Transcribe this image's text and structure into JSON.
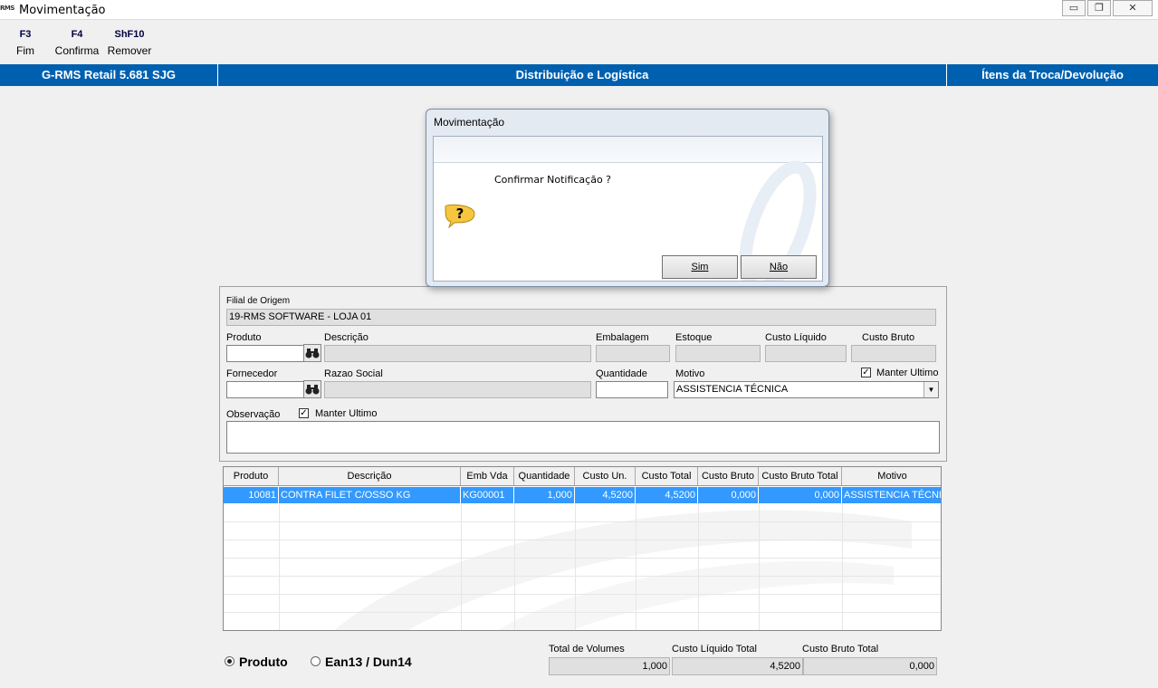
{
  "window": {
    "title": "Movimentação",
    "app_icon_text": "RMS",
    "min": "▭",
    "restore": "❐",
    "close": "✕"
  },
  "fkeys": [
    {
      "key": "F3",
      "label": "Fim"
    },
    {
      "key": "F4",
      "label": "Confirma"
    },
    {
      "key": "ShF10",
      "label": "Remover"
    }
  ],
  "header": {
    "left": "G-RMS Retail 5.681 SJG",
    "center": "Distribuição e Logística",
    "right": "Ítens da Troca/Devolução"
  },
  "form": {
    "filial_label": "Filial de Origem",
    "filial_value": "19-RMS SOFTWARE - LOJA 01",
    "produto_label": "Produto",
    "descricao_label": "Descrição",
    "embalagem_label": "Embalagem",
    "estoque_label": "Estoque",
    "custo_liquido_label": "Custo Líquido",
    "custo_bruto_label": "Custo Bruto",
    "fornecedor_label": "Fornecedor",
    "razao_social_label": "Razao Social",
    "quantidade_label": "Quantidade",
    "motivo_label": "Motivo",
    "motivo_value": "ASSISTENCIA TÉCNICA",
    "manter_ultimo_label": "Manter Ultimo",
    "observacao_label": "Observação",
    "manter_ultimo2_label": "Manter Ultimo"
  },
  "grid": {
    "columns": [
      "Produto",
      "Descrição",
      "Emb Vda",
      "Quantidade",
      "Custo Un.",
      "Custo Total",
      "Custo Bruto",
      "Custo Bruto Total",
      "Motivo"
    ],
    "rows": [
      [
        "10081",
        "CONTRA FILET C/OSSO KG",
        "KG00001",
        "1,000",
        "4,5200",
        "4,5200",
        "0,000",
        "0,000",
        "ASSISTENCIA TÉCNICA"
      ]
    ]
  },
  "footer": {
    "radio_produto": "Produto",
    "radio_ean": "Ean13 / Dun14",
    "total_volumes_label": "Total de  Volumes",
    "custo_liquido_total_label": "Custo Líquido Total",
    "custo_bruto_total_label": "Custo Bruto Total",
    "total_volumes_value": "1,000",
    "custo_liquido_total_value": "4,5200",
    "custo_bruto_total_value": "0,000"
  },
  "dialog": {
    "title": "Movimentação",
    "message": "Confirmar Notificação ?",
    "yes_label": "Sim",
    "no_label": "Não"
  }
}
